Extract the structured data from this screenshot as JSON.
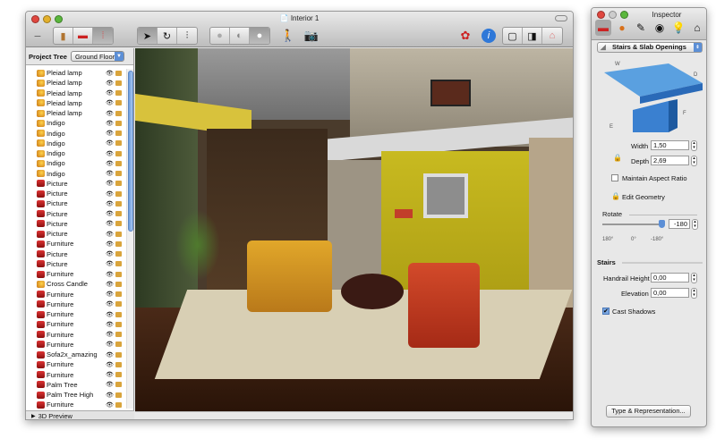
{
  "window": {
    "title": "Interior 1"
  },
  "toolbar": {
    "groups": [
      [
        "library-icon",
        "furniture-icon",
        "layers-icon"
      ],
      [
        "arrow-icon",
        "rotate-icon",
        "sliders-icon"
      ],
      [
        "circle-icon",
        "eye-view-icon",
        "person-view-icon"
      ]
    ],
    "walk_icon": "walk-icon",
    "camera_icon": "camera-icon",
    "render_icon": "render-icon",
    "info_icon": "info-icon",
    "view_icons": [
      "plan-view-icon",
      "split-view-icon",
      "3d-view-icon"
    ]
  },
  "project_tree": {
    "label": "Project Tree",
    "floor": "Ground Floor",
    "items": [
      {
        "name": "Pleiad lamp",
        "type": "lamp"
      },
      {
        "name": "Pleiad lamp",
        "type": "lamp"
      },
      {
        "name": "Pleiad lamp",
        "type": "lamp"
      },
      {
        "name": "Pleiad lamp",
        "type": "lamp"
      },
      {
        "name": "Pleiad lamp",
        "type": "lamp"
      },
      {
        "name": "Indigo",
        "type": "lamp"
      },
      {
        "name": "Indigo",
        "type": "lamp"
      },
      {
        "name": "Indigo",
        "type": "lamp"
      },
      {
        "name": "Indigo",
        "type": "lamp"
      },
      {
        "name": "Indigo",
        "type": "lamp"
      },
      {
        "name": "Indigo",
        "type": "lamp"
      },
      {
        "name": "Picture",
        "type": "furn"
      },
      {
        "name": "Picture",
        "type": "furn"
      },
      {
        "name": "Picture",
        "type": "furn"
      },
      {
        "name": "Picture",
        "type": "furn"
      },
      {
        "name": "Picture",
        "type": "furn"
      },
      {
        "name": "Picture",
        "type": "furn"
      },
      {
        "name": "Furniture",
        "type": "furn"
      },
      {
        "name": "Picture",
        "type": "furn"
      },
      {
        "name": "Picture",
        "type": "furn"
      },
      {
        "name": "Furniture",
        "type": "furn"
      },
      {
        "name": "Cross Candle",
        "type": "lamp"
      },
      {
        "name": "Furniture",
        "type": "furn"
      },
      {
        "name": "Furniture",
        "type": "furn"
      },
      {
        "name": "Furniture",
        "type": "furn"
      },
      {
        "name": "Furniture",
        "type": "furn"
      },
      {
        "name": "Furniture",
        "type": "furn"
      },
      {
        "name": "Furniture",
        "type": "furn"
      },
      {
        "name": "Sofa2x_amazing",
        "type": "furn"
      },
      {
        "name": "Furniture",
        "type": "furn"
      },
      {
        "name": "Furniture",
        "type": "furn"
      },
      {
        "name": "Palm Tree",
        "type": "furn"
      },
      {
        "name": "Palm Tree High",
        "type": "furn"
      },
      {
        "name": "Furniture",
        "type": "furn"
      }
    ],
    "footer": "3D Preview"
  },
  "inspector": {
    "title": "Inspector",
    "tabs": [
      "furniture-icon",
      "material-icon",
      "pencil-icon",
      "camera-icon",
      "light-icon",
      "house-icon"
    ],
    "type_select": "Stairs & Slab Openings",
    "diagram_labels": {
      "w": "W",
      "d": "D",
      "f": "F",
      "e": "E"
    },
    "width_label": "Width",
    "width": "1,50",
    "depth_label": "Depth",
    "depth": "2,69",
    "maintain_aspect": "Maintain Aspect Ratio",
    "maintain_aspect_checked": false,
    "edit_geometry": "Edit Geometry",
    "rotate_label": "Rotate",
    "rotate": "-180",
    "rotate_ticks": [
      "180°",
      "0°",
      "-180°"
    ],
    "stairs_label": "Stairs",
    "handrail_label": "Handrail Height",
    "handrail": "0,00",
    "elevation_label": "Elevation",
    "elevation": "0,00",
    "cast_shadows": "Cast Shadows",
    "cast_shadows_checked": true,
    "type_button": "Type & Representation..."
  }
}
